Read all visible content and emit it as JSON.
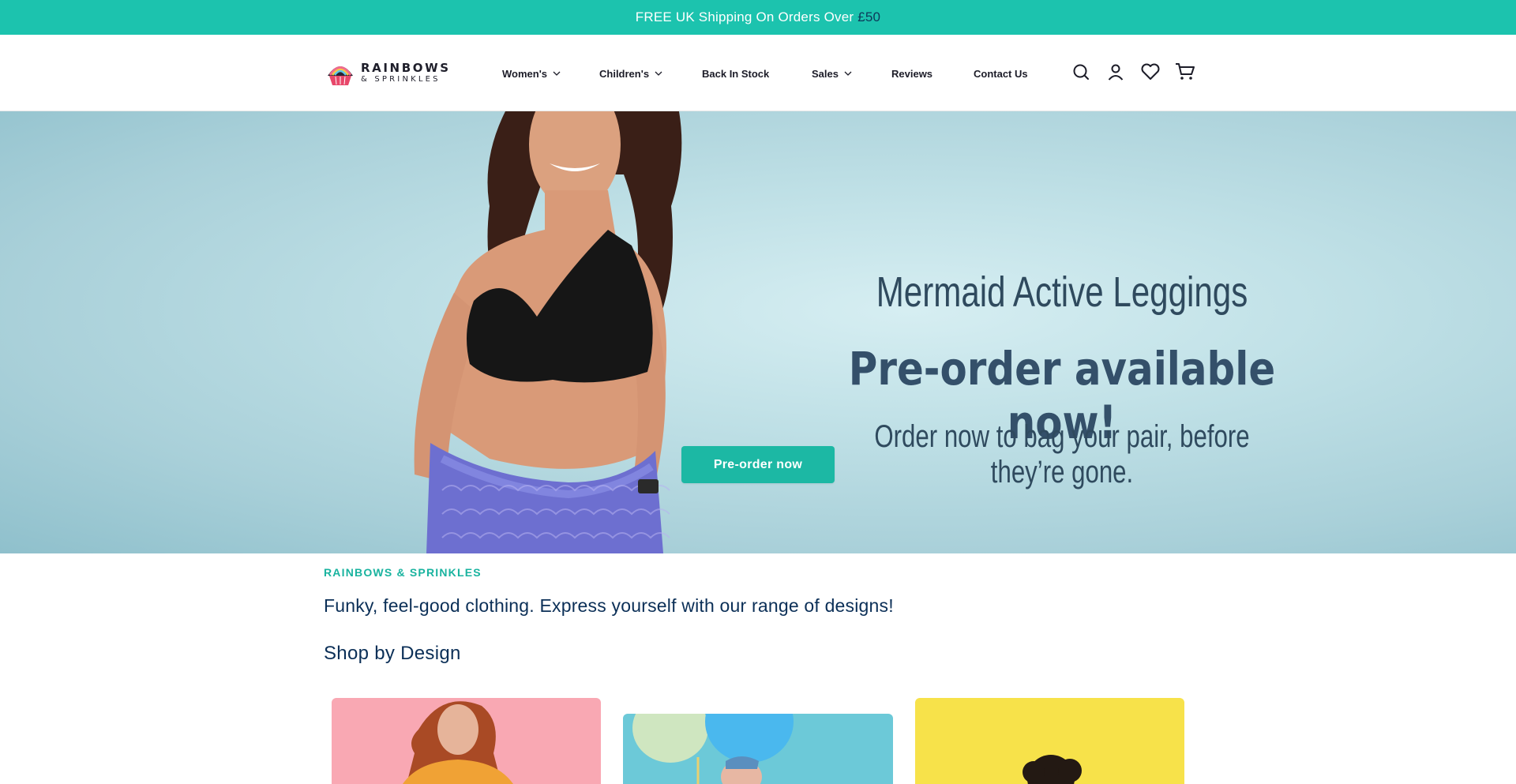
{
  "announcement": {
    "text": "FREE UK Shipping On Orders Over",
    "amount": "£50"
  },
  "header": {
    "logo": {
      "line1": "RAINBOWS",
      "line2": "& SPRINKLES"
    },
    "nav": [
      {
        "label": "Women's",
        "has_dropdown": true
      },
      {
        "label": "Children's",
        "has_dropdown": true
      },
      {
        "label": "Back In Stock",
        "has_dropdown": false
      },
      {
        "label": "Sales",
        "has_dropdown": true
      },
      {
        "label": "Reviews",
        "has_dropdown": false
      },
      {
        "label": "Contact Us",
        "has_dropdown": false
      }
    ],
    "icons": [
      "search-icon",
      "account-icon",
      "heart-icon",
      "cart-icon"
    ]
  },
  "hero": {
    "title": "Mermaid Active Leggings",
    "subtitle": "Pre-order available now!",
    "body": "Order now to bag your pair, before they’re gone.",
    "button_label": "Pre-order now"
  },
  "intro": {
    "eyebrow": "RAINBOWS & SPRINKLES",
    "tagline": "Funky, feel-good clothing. Express yourself with our range of designs!"
  },
  "shop_by_design": {
    "heading": "Shop by Design"
  },
  "colors": {
    "accent": "#1cc3ae",
    "button": "#1cb8a4",
    "heading_text": "#0b2f57",
    "card_pink": "#f9a8b3",
    "card_blue": "#6cc9d8",
    "card_yellow": "#f7e24a"
  }
}
